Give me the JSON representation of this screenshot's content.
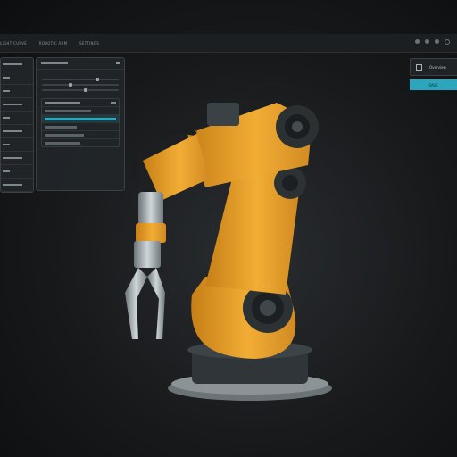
{
  "topbar": {
    "menu_items": [
      "LIGHT CURVE",
      "ROBOTIC ARM",
      "SETTINGS"
    ]
  },
  "right": {
    "card_label": "Overview",
    "button_label": "SAVE"
  },
  "colors": {
    "accent": "#2ba6bc",
    "robot_body": "#f1a92f"
  },
  "icons": [
    "window-min-icon",
    "window-max-icon",
    "window-close-icon",
    "cube-icon"
  ]
}
